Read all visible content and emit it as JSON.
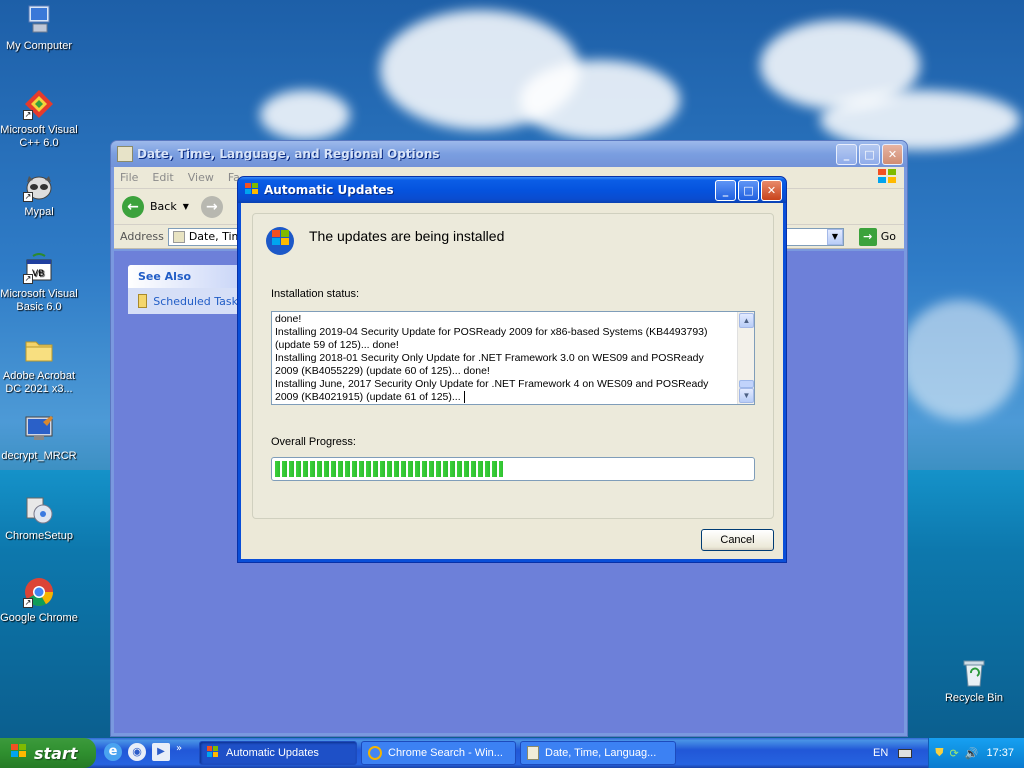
{
  "desktop": {
    "icons": [
      {
        "label": "My Computer",
        "icon": "computer-icon"
      },
      {
        "label": "Microsoft Visual C++ 6.0",
        "icon": "visual-cpp-icon"
      },
      {
        "label": "Mypal",
        "icon": "mypal-icon"
      },
      {
        "label": "Microsoft Visual Basic 6.0",
        "icon": "visual-basic-icon"
      },
      {
        "label": "Adobe Acrobat DC 2021 x3...",
        "icon": "folder-icon"
      },
      {
        "label": "decrypt_MRCR",
        "icon": "monitor-icon"
      },
      {
        "label": "ChromeSetup",
        "icon": "setup-icon"
      },
      {
        "label": "Google Chrome",
        "icon": "chrome-icon"
      },
      {
        "label": "Recycle Bin",
        "icon": "recycle-bin-icon"
      }
    ]
  },
  "explorer": {
    "title": "Date, Time, Language, and Regional Options",
    "menu": [
      "File",
      "Edit",
      "View",
      "Fa"
    ],
    "back_label": "Back",
    "address_label": "Address",
    "address_value": "Date, Time",
    "go_label": "Go",
    "see_also": {
      "heading": "See Also",
      "item": "Scheduled Task"
    }
  },
  "dialog": {
    "title": "Automatic Updates",
    "heading": "The updates are being installed",
    "status_label": "Installation status:",
    "log_lines": [
      "done!",
      "Installing 2019-04 Security Update for POSReady 2009 for x86-based Systems (KB4493793)",
      "(update 59 of 125)... done!",
      "Installing 2018-01 Security Only Update for .NET Framework 3.0 on WES09 and POSReady",
      "2009 (KB4055229) (update 60 of 125)... done!",
      "Installing June, 2017 Security Only Update for .NET Framework 4 on WES09 and POSReady",
      "2009 (KB4021915) (update 61 of 125)..."
    ],
    "progress_label": "Overall Progress:",
    "progress_fraction": 0.48,
    "cancel_label": "Cancel"
  },
  "taskbar": {
    "start_label": "start",
    "tasks": [
      "Automatic Updates",
      "Chrome Search - Win...",
      "Date, Time, Languag..."
    ],
    "language": "EN",
    "clock": "17:37"
  },
  "colors": {
    "xp_blue": "#0553de",
    "progress_green": "#3bd13b",
    "explorer_body": "#6d80d9"
  }
}
